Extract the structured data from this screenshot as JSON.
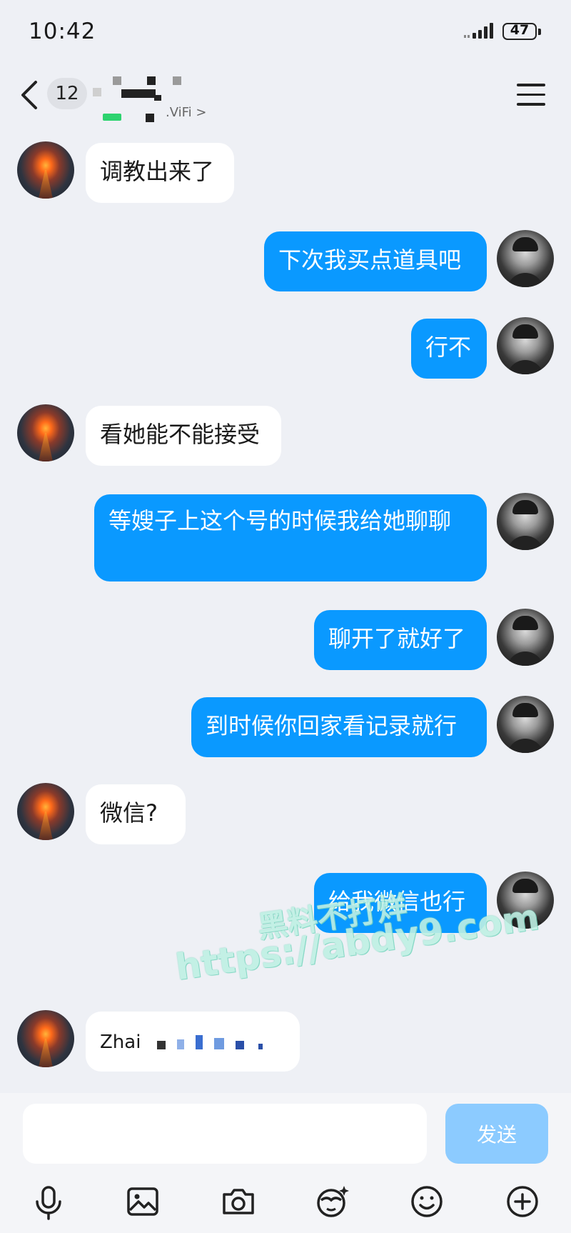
{
  "status_bar": {
    "time": "10:42",
    "battery": "47"
  },
  "header": {
    "unread_count": "12",
    "network_status": ".ViFi >"
  },
  "messages": [
    {
      "side": "in",
      "text": "调教出来了"
    },
    {
      "side": "out",
      "text": "下次我买点道具吧"
    },
    {
      "side": "out",
      "text": "行不"
    },
    {
      "side": "in",
      "text": "看她能不能接受"
    },
    {
      "side": "out",
      "text": "等嫂子上这个号的时候我给她聊聊"
    },
    {
      "side": "out",
      "text": "聊开了就好了"
    },
    {
      "side": "out",
      "text": "到时候你回家看记录就行"
    },
    {
      "side": "in",
      "text": "微信?"
    },
    {
      "side": "out",
      "text": "给我微信也行"
    },
    {
      "side": "in",
      "text": "Zhai"
    }
  ],
  "watermark": {
    "line1": "黑料不打烊",
    "line2": "https://abdy9.com"
  },
  "input": {
    "placeholder": "",
    "send_label": "发送"
  },
  "toolbar": {
    "icons": [
      "microphone-icon",
      "image-icon",
      "camera-icon",
      "sticker-icon",
      "emoji-icon",
      "plus-icon"
    ]
  },
  "colors": {
    "outgoing_bubble": "#0a99ff",
    "incoming_bubble": "#ffffff",
    "background": "#eef0f5",
    "send_button": "#8ccbff"
  }
}
